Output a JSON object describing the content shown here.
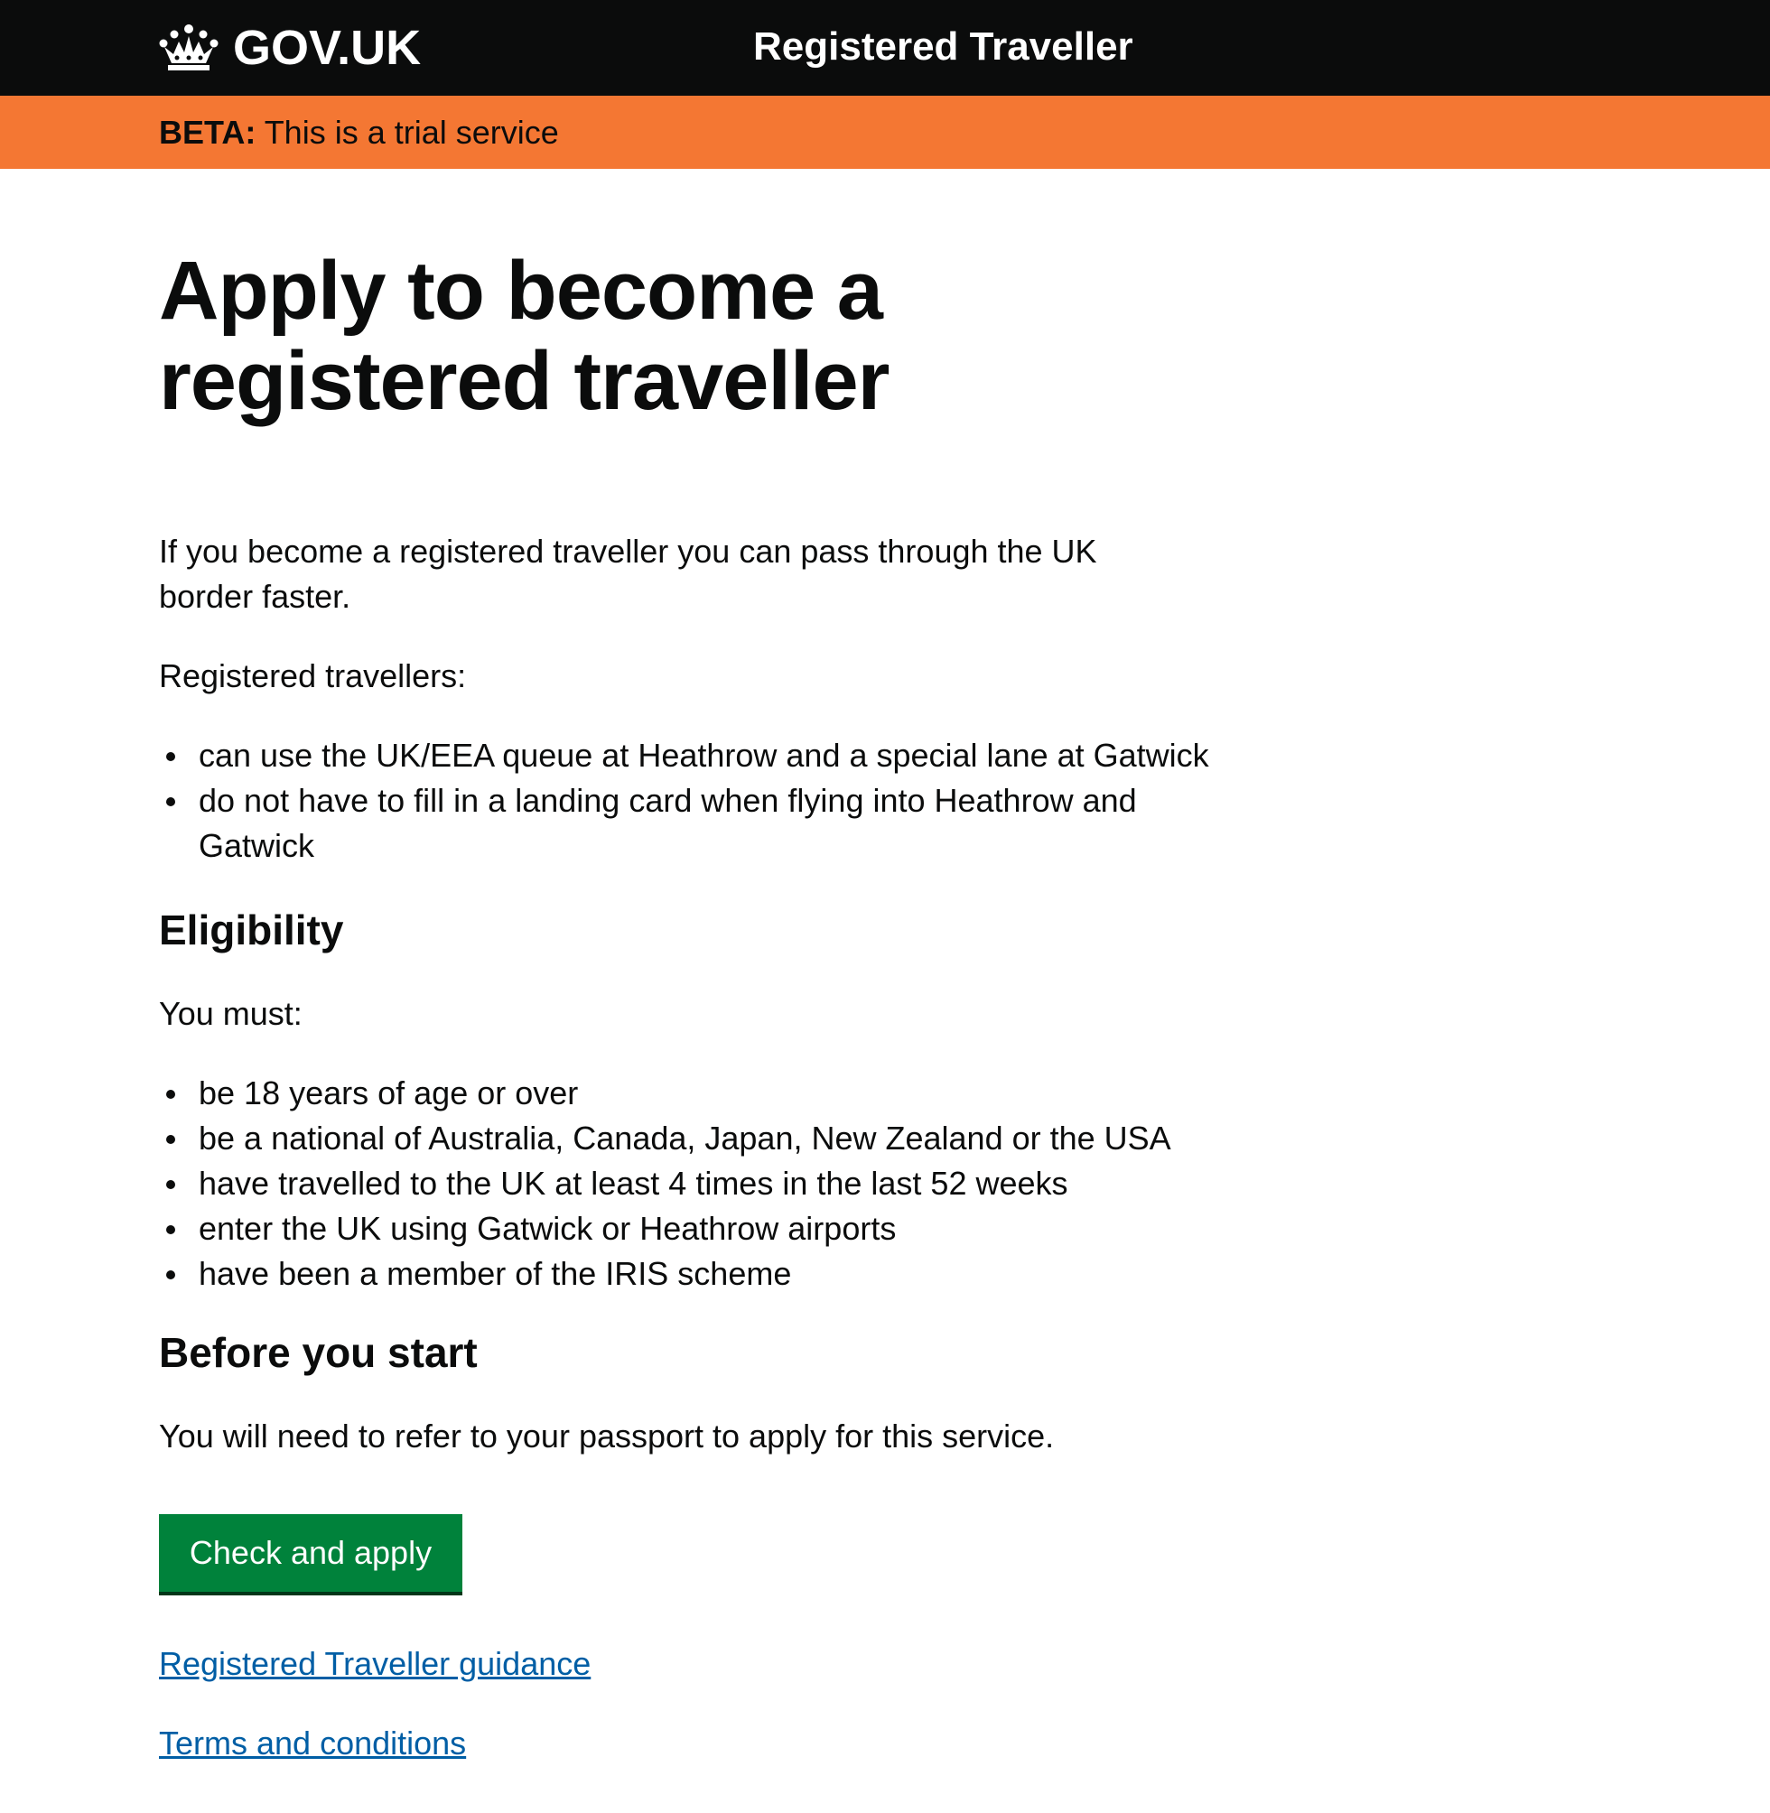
{
  "header": {
    "logo_text": "GOV.UK",
    "logo_icon": "crown-icon",
    "service_name": "Registered Traveller"
  },
  "beta_banner": {
    "tag": "BETA:",
    "text": "This is a trial service"
  },
  "main": {
    "title": "Apply to become a registered traveller",
    "intro": "If you become a registered traveller you can pass through the UK border faster.",
    "benefits_lead": "Registered travellers:",
    "benefits": [
      "can use the UK/EEA queue at Heathrow and a special lane at Gatwick",
      "do not have to fill in a landing card when flying into Heathrow and Gatwick"
    ],
    "eligibility_heading": "Eligibility",
    "eligibility_lead": "You must:",
    "eligibility": [
      "be 18 years of age or over",
      "be a national of Australia, Canada, Japan, New Zealand or the USA",
      "have travelled to the UK at least 4 times in the last 52 weeks",
      "enter the UK using Gatwick or Heathrow airports",
      "have been a member of the IRIS scheme"
    ],
    "before_heading": "Before you start",
    "before_text": "You will need to refer to your passport to apply for this service.",
    "start_button": "Check and apply",
    "links": [
      "Registered Traveller guidance",
      "Terms and conditions"
    ]
  },
  "colors": {
    "header_bg": "#0b0c0c",
    "beta_bg": "#f47733",
    "button_bg": "#00823b",
    "link": "#005ea5"
  }
}
